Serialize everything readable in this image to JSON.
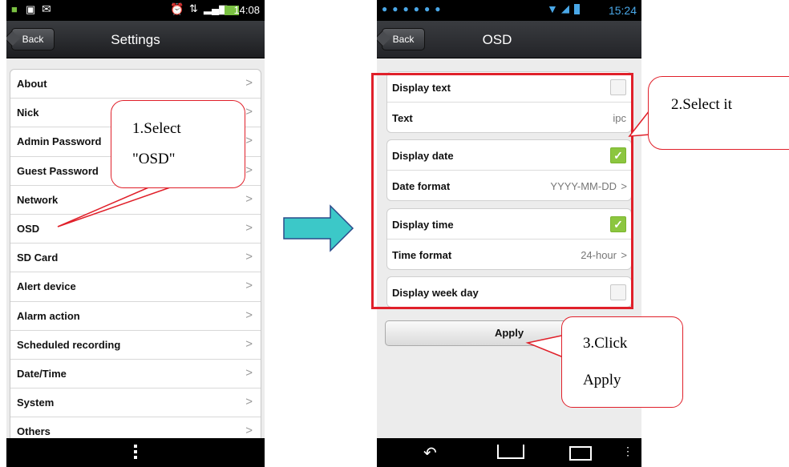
{
  "left_phone": {
    "status_time": "14:08",
    "back_label": "Back",
    "title": "Settings",
    "items": [
      {
        "label": "About"
      },
      {
        "label": "Nick"
      },
      {
        "label": "Admin Password"
      },
      {
        "label": "Guest Password"
      },
      {
        "label": "Network"
      },
      {
        "label": "OSD"
      },
      {
        "label": "SD Card"
      },
      {
        "label": "Alert device"
      },
      {
        "label": "Alarm action"
      },
      {
        "label": "Scheduled recording"
      },
      {
        "label": "Date/Time"
      },
      {
        "label": "System"
      },
      {
        "label": "Others"
      }
    ]
  },
  "right_phone": {
    "status_time": "15:24",
    "back_label": "Back",
    "title": "OSD",
    "display_text_label": "Display text",
    "display_text_checked": false,
    "text_label": "Text",
    "text_value": "ipc",
    "display_date_label": "Display date",
    "display_date_checked": true,
    "date_format_label": "Date format",
    "date_format_value": "YYYY-MM-DD",
    "display_time_label": "Display time",
    "display_time_checked": true,
    "time_format_label": "Time format",
    "time_format_value": "24-hour",
    "display_week_day_label": "Display week day",
    "display_week_day_checked": false,
    "apply_label": "Apply"
  },
  "annotations": {
    "step1_line1": "1.Select",
    "step1_line2": "\"OSD\"",
    "step2": "2.Select it",
    "step3_line1": "3.Click",
    "step3_line2": "Apply",
    "accent_color": "#e0202a",
    "arrow_color": "#3cc8c8"
  }
}
